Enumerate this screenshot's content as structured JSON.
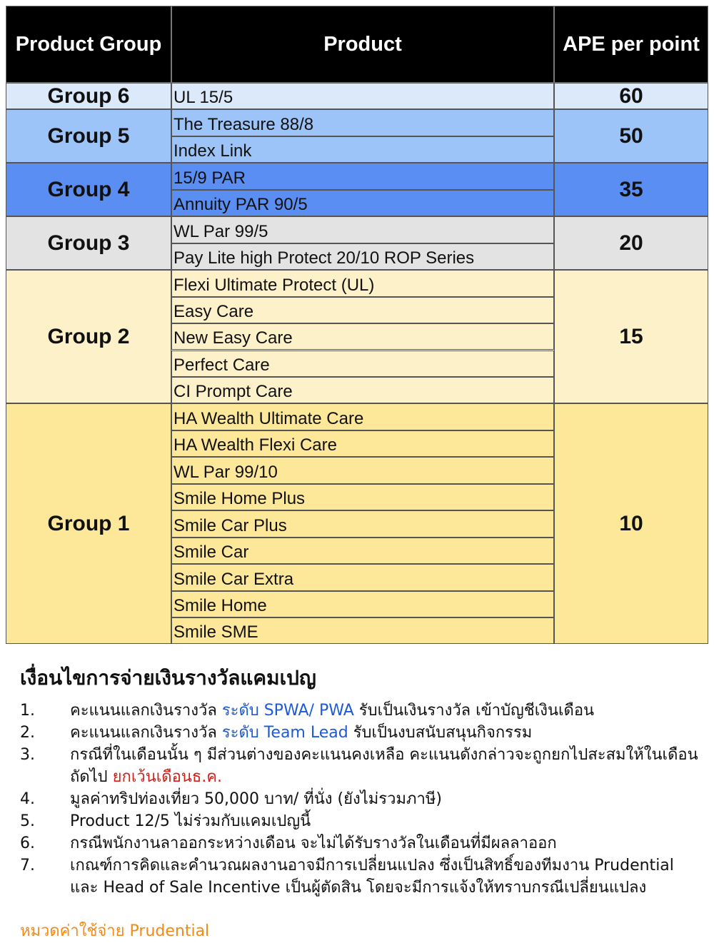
{
  "table": {
    "headers": {
      "group": "Product Group",
      "product": "Product",
      "ape": "APE per point"
    },
    "groups": [
      {
        "name": "Group 6",
        "ape": "60",
        "color": "#dbe9fb",
        "products": [
          "UL 15/5"
        ]
      },
      {
        "name": "Group 5",
        "ape": "50",
        "color": "#9cc4f9",
        "products": [
          "The Treasure 88/8",
          "Index Link"
        ]
      },
      {
        "name": "Group 4",
        "ape": "35",
        "color": "#5b8ef2",
        "products": [
          "15/9 PAR",
          "Annuity PAR 90/5"
        ]
      },
      {
        "name": "Group 3",
        "ape": "20",
        "color": "#e3e3e3",
        "products": [
          "WL Par 99/5",
          "Pay Lite high Protect 20/10 ROP Series"
        ]
      },
      {
        "name": "Group 2",
        "ape": "15",
        "color": "#fdf1c9",
        "products": [
          "Flexi Ultimate Protect (UL)",
          "Easy Care",
          "New Easy Care",
          "Perfect Care",
          "CI Prompt Care"
        ]
      },
      {
        "name": "Group 1",
        "ape": "10",
        "color": "#fde89a",
        "products": [
          "HA Wealth Ultimate Care",
          "HA Wealth Flexi Care",
          "WL Par 99/10",
          "Smile Home Plus",
          "Smile Car Plus",
          "Smile Car",
          "Smile Car Extra",
          "Smile Home",
          "Smile SME"
        ]
      }
    ]
  },
  "notes": {
    "title": "เงื่อนไขการจ่ายเงินรางวัลแคมเปญ",
    "items": [
      {
        "num": "1.",
        "text_a": "คะแนนแลกเงินรางวัล ",
        "highlight": "ระดับ SPWA/ PWA",
        "text_b": " รับเป็นเงินรางวัล เข้าบัญชีเงินเดือน"
      },
      {
        "num": "2.",
        "text_a": "คะแนนแลกเงินรางวัล ",
        "highlight": "ระดับ Team Lead",
        "text_b": " รับเป็นงบสนับสนุนกิจกรรม"
      },
      {
        "num": "3.",
        "text_a": "กรณีที่ในเดือนนั้น ๆ มีส่วนต่างของคะแนนคงเหลือ คะแนนดังกล่าวจะถูกยกไปสะสมให้ในเดือนถัดไป ",
        "warning": "ยกเว้นเดือนธ.ค."
      },
      {
        "num": "4.",
        "text_a": "มูลค่าทริปท่องเที่ยว 50,000 บาท/ ที่นั่ง (ยังไม่รวมภาษี)"
      },
      {
        "num": "5.",
        "text_a": "Product 12/5 ไม่ร่วมกับแคมเปญนี้"
      },
      {
        "num": "6.",
        "text_a": "กรณีพนักงานลาออกระหว่างเดือน จะไม่ได้รับรางวัลในเดือนที่มีผลลาออก"
      },
      {
        "num": "7.",
        "text_a": "เกณฑ์การคิดและคำนวณผลงานอาจมีการเปลี่ยนแปลง ซึ่งเป็นสิทธิ์ของทีมงาน Prudential และ Head of Sale Incentive เป็นผู้ตัดสิน โดยจะมีการแจ้งให้ทราบกรณีเปลี่ยนแปลง"
      }
    ]
  },
  "footer": "หมวดค่าใช้จ่าย Prudential"
}
